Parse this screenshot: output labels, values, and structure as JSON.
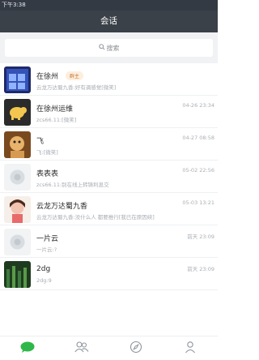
{
  "statusbar": {
    "text": "下午3:38"
  },
  "header": {
    "title": "会话"
  },
  "search": {
    "placeholder": "搜索",
    "icon": "search-icon"
  },
  "conversations": [
    {
      "title": "在徐州",
      "badge": "群主",
      "snippet": "云龙万达蜀九香:好有调感觉[微笑]",
      "time": ""
    },
    {
      "title": "在徐州运维",
      "snippet": "zcs66.11:[微笑]",
      "time": "04-26 23:34"
    },
    {
      "title": "飞",
      "snippet": "飞:[微笑]",
      "time": "04-27 08:58"
    },
    {
      "title": "表表表",
      "snippet": "zcs66.11:别在线上转铸利息交",
      "time": "05-02 22:56"
    },
    {
      "title": "云龙万达蜀九香",
      "snippet": "云龙万达蜀九香:没什么人 都要推行[我已在原因续]",
      "time": "05-03 13:21"
    },
    {
      "title": "一片云",
      "snippet": "一片云:?",
      "time": "前天 23:09"
    },
    {
      "title": "2dg",
      "snippet": "2dg:9",
      "time": "前天 23:09"
    }
  ],
  "tabs": [
    {
      "name": "chat",
      "icon": "chat-bubble-icon",
      "active_color": "#2fb84a"
    },
    {
      "name": "contacts",
      "icon": "contacts-icon"
    },
    {
      "name": "discover",
      "icon": "compass-icon"
    },
    {
      "name": "me",
      "icon": "person-icon"
    }
  ],
  "colors": {
    "header": "#3b4149",
    "accent_green": "#2fb84a",
    "badge_text": "#c27a3f"
  }
}
